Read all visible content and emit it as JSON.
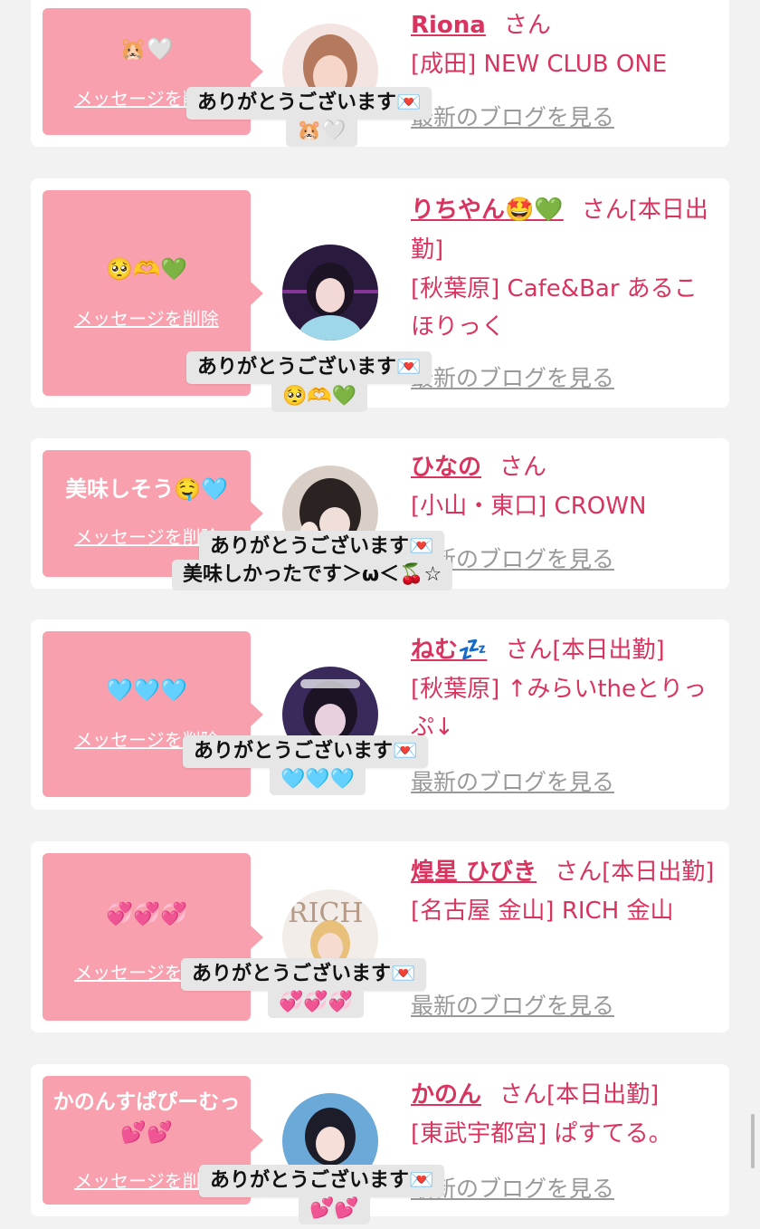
{
  "delete_label": "メッセージを削除",
  "blog_label": "最新のブログを見る",
  "san": "さん",
  "reply_thanks": "ありがとうございます💌",
  "colors": {
    "accent": "#d8345f",
    "bubble": "#f8a0ae",
    "muted": "#999999"
  },
  "entries": [
    {
      "message": "🐹🤍",
      "name": "Riona",
      "status": "",
      "shop": "[成田] NEW CLUB ONE",
      "reply_line2": "🐹🤍"
    },
    {
      "message": "🥺🫶💚",
      "name": "りちやん🤩💚",
      "status": "[本日出勤]",
      "shop": "[秋葉原] Cafe&Bar あるこほりっく",
      "reply_line2": "🥺🫶💚"
    },
    {
      "message": "美味しそう🤤🩵",
      "name": "ひなの",
      "status": "",
      "shop": "[小山・東口] CROWN",
      "reply_line2": "美味しかったです＞ω＜🍒☆"
    },
    {
      "message": "🩵🩵🩵",
      "name": "ねむ💤",
      "status": "[本日出勤]",
      "shop": "[秋葉原] ↑みらいtheとりっぷ↓",
      "reply_line2": "🩵🩵🩵"
    },
    {
      "message": "💞💞💞",
      "name": "煌星 ひびき",
      "status": "[本日出勤]",
      "shop": "[名古屋 金山] RICH 金山",
      "reply_line2": "💞💞💞"
    },
    {
      "message": "かのんすぱぴーむっ💕💕",
      "name": "かのん",
      "status": "[本日出勤]",
      "shop": "[東武宇都宮] ぱすてる。",
      "reply_line2": "💕💕"
    }
  ]
}
